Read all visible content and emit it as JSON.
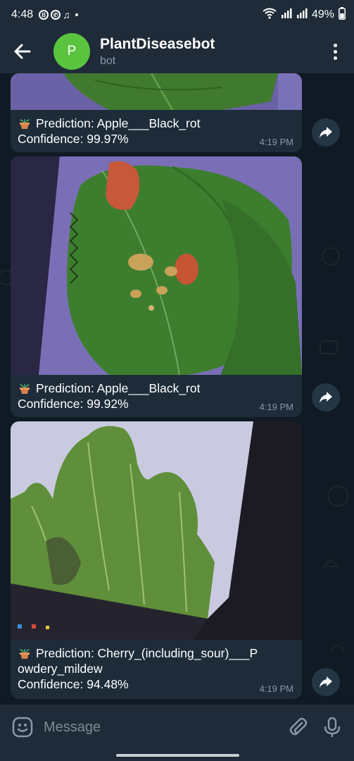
{
  "status_bar": {
    "time": "4:48",
    "battery": "49%",
    "icons": [
      "b-badge-icon",
      "whatsapp-icon",
      "audio-icon"
    ]
  },
  "header": {
    "avatar_letter": "P",
    "title": "PlantDiseasebot",
    "subtitle": "bot"
  },
  "messages": [
    {
      "prediction": "Prediction: Apple___Black_rot",
      "confidence": "Confidence: 99.97%",
      "time": "4:19 PM"
    },
    {
      "prediction": "Prediction: Apple___Black_rot",
      "confidence": "Confidence: 99.92%",
      "time": "4:19 PM"
    },
    {
      "prediction_line1": "Prediction: Cherry_(including_sour)___P",
      "prediction_line2": "owdery_mildew",
      "confidence": "Confidence: 94.48%",
      "time": "4:19 PM"
    }
  ],
  "composer": {
    "placeholder": "Message"
  },
  "colors": {
    "accent_avatar": "#5ac43e",
    "bubble": "#1e2c3a",
    "chat_bg": "#0f1a24",
    "bar_bg": "#1f2b38"
  }
}
